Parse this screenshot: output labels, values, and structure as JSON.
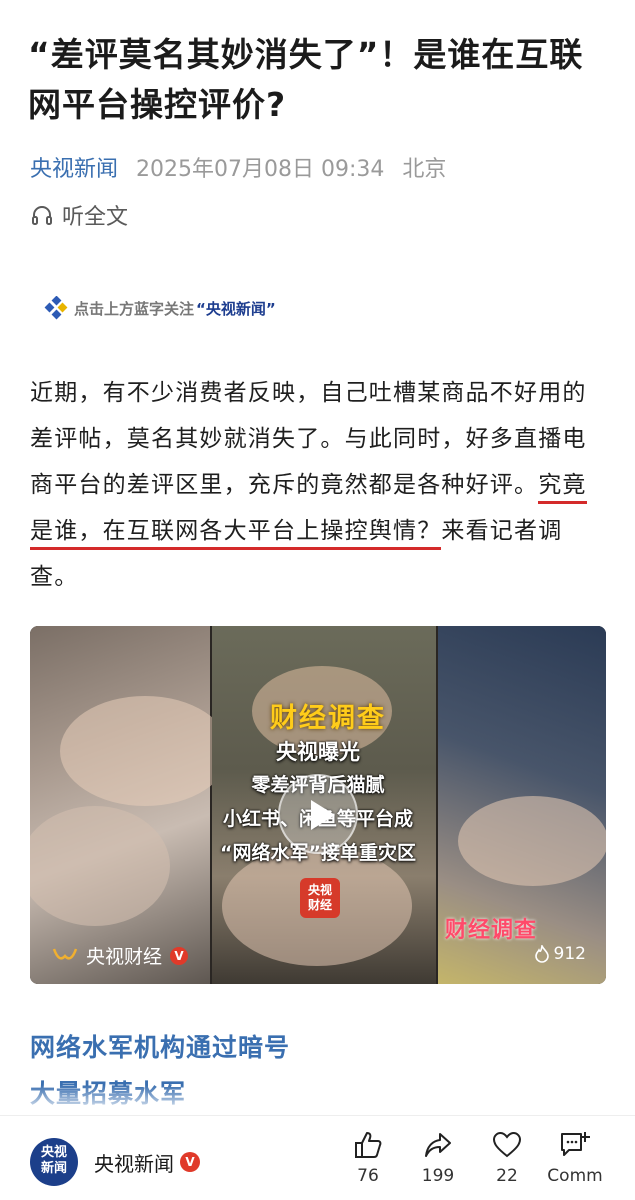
{
  "article": {
    "title_line1": "“差评莫名其妙消失了”！是谁在互联",
    "title_line2": "网平台操控评价?",
    "source": "央视新闻",
    "date": "2025年07月08日 09:34",
    "location": "北京",
    "listen_label": "听全文",
    "follow_prefix": "点击上方蓝字关注",
    "follow_brand": "“央视新闻”",
    "paragraph_plain": "近期，有不少消费者反映，自己吐槽某商品不好用的差评帖，莫名其妙就消失了。与此同时，好多直播电商平台的差评区里，充斥的竟然都是各种好评。",
    "paragraph_underlined_a": "究竟是谁，在互联网各大平台上操控舆",
    "paragraph_underlined_b": "情？",
    "paragraph_tail": "来看记者调查。",
    "subhead_line1": "网络水军机构通过暗号",
    "subhead_line2": "大量招募水军"
  },
  "video": {
    "title": "财经调查",
    "line1": "央视曝光",
    "line2": "零差评背后猫腻",
    "line3": "小红书、闲鱼等平台成",
    "line4": "“网络水军”接单重灾区",
    "badge_line1": "央视",
    "badge_line2": "财经",
    "watermark": "财经调查",
    "channel": "央视财经",
    "verified": "V",
    "likes": "912"
  },
  "bottom_bar": {
    "avatar_line1": "央视",
    "avatar_line2": "新闻",
    "account_name": "央视新闻",
    "verified": "V",
    "like_count": "76",
    "share_count": "199",
    "favorite_count": "22",
    "comment_label": "Comm"
  },
  "colors": {
    "accent_blue": "#3a6fb0",
    "underline_red": "#d42a2a",
    "video_title_yellow": "#ffcc1a"
  }
}
